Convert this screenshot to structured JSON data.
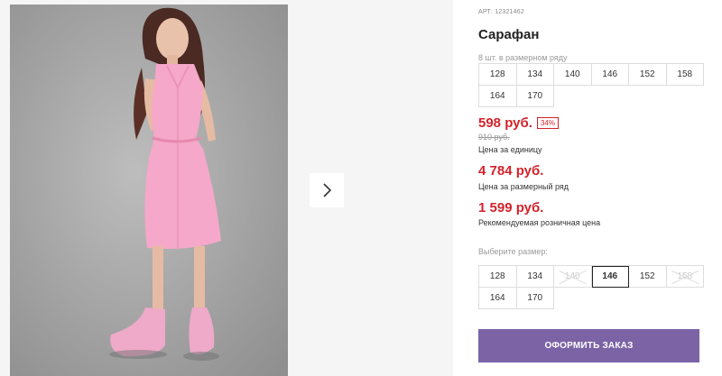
{
  "product": {
    "article_label": "АРТ: 12321462",
    "title": "Сарафан",
    "row_note": "8 шт. в размерном ряду",
    "row_sizes": [
      "128",
      "134",
      "140",
      "146",
      "152",
      "158",
      "164",
      "170"
    ]
  },
  "prices": {
    "unit_price": "598 руб.",
    "discount": "34%",
    "old_price": "910 руб.",
    "unit_caption": "Цена за единицу",
    "row_price": "4 784 руб.",
    "row_caption": "Цена за размерный ряд",
    "retail_price": "1 599 руб.",
    "retail_caption": "Рекомендуемая розничная цена"
  },
  "size_picker": {
    "label": "Выберите размер:",
    "selected": "146",
    "options": [
      {
        "size": "128",
        "available": true
      },
      {
        "size": "134",
        "available": true
      },
      {
        "size": "140",
        "available": false
      },
      {
        "size": "146",
        "available": true
      },
      {
        "size": "152",
        "available": true
      },
      {
        "size": "158",
        "available": false
      },
      {
        "size": "164",
        "available": true
      },
      {
        "size": "170",
        "available": true
      }
    ]
  },
  "order_button_label": "ОФОРМИТЬ ЗАКАЗ",
  "gallery": {
    "next_icon": "chevron-right-icon",
    "photo": "product-photo"
  },
  "colors": {
    "accent_red": "#d3222a",
    "order_button": "#7b63a6",
    "dress_pink": "#f5a8c9"
  }
}
